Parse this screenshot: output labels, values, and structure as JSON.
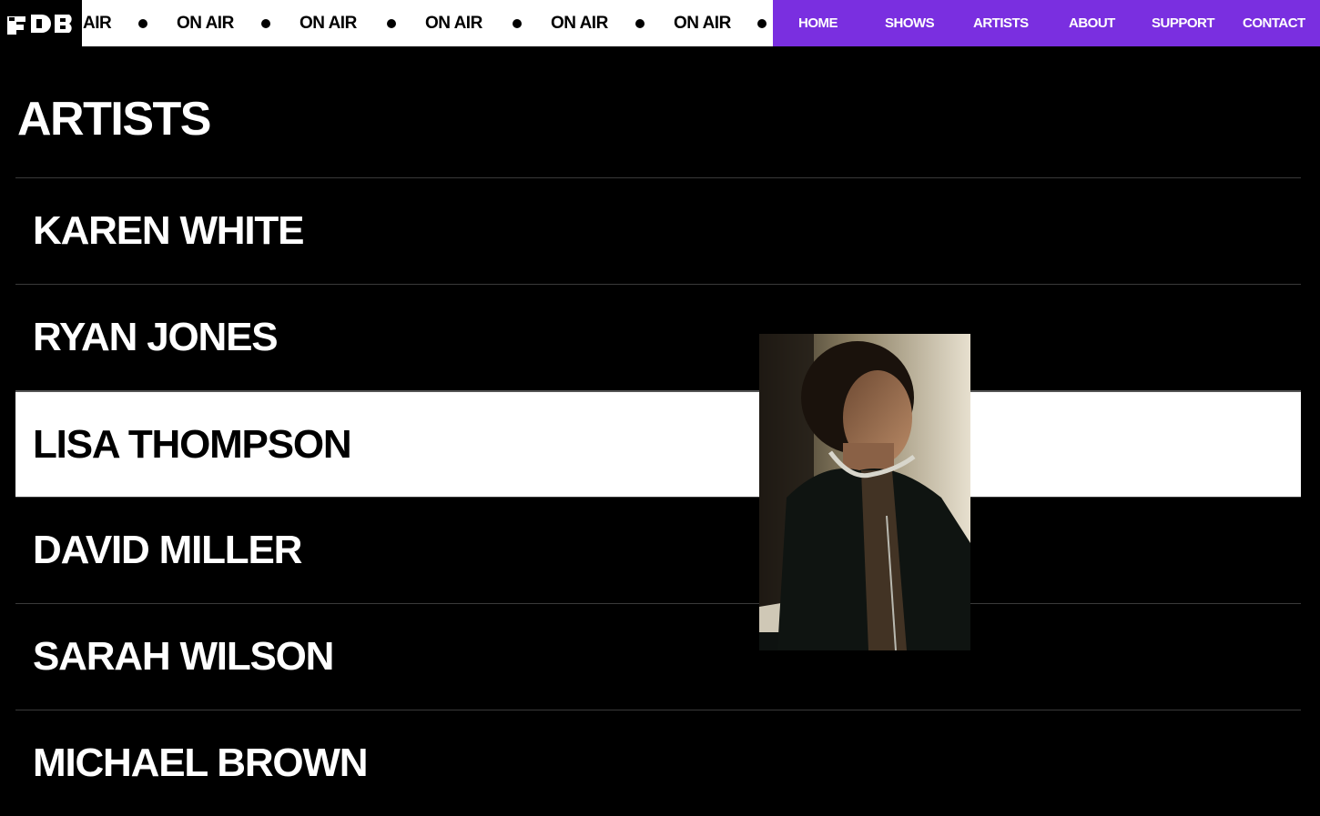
{
  "ticker": {
    "items": [
      "AIR",
      "ON AIR",
      "ON AIR",
      "ON AIR",
      "ON AIR",
      "ON AIR"
    ]
  },
  "nav": {
    "items": [
      "HOME",
      "SHOWS",
      "ARTISTS",
      "ABOUT",
      "SUPPORT",
      "CONTACT"
    ]
  },
  "page": {
    "title": "ARTISTS"
  },
  "artists": [
    "KAREN WHITE",
    "RYAN JONES",
    "LISA THOMPSON",
    "DAVID MILLER",
    "SARAH WILSON",
    "MICHAEL BROWN"
  ],
  "active_artist": "LISA THOMPSON",
  "colors": {
    "background": "#000000",
    "nav_accent": "#7a2fe0",
    "ticker_bg": "#ffffff",
    "text": "#ffffff"
  },
  "preview": {
    "icon": "artist-portrait-image"
  }
}
